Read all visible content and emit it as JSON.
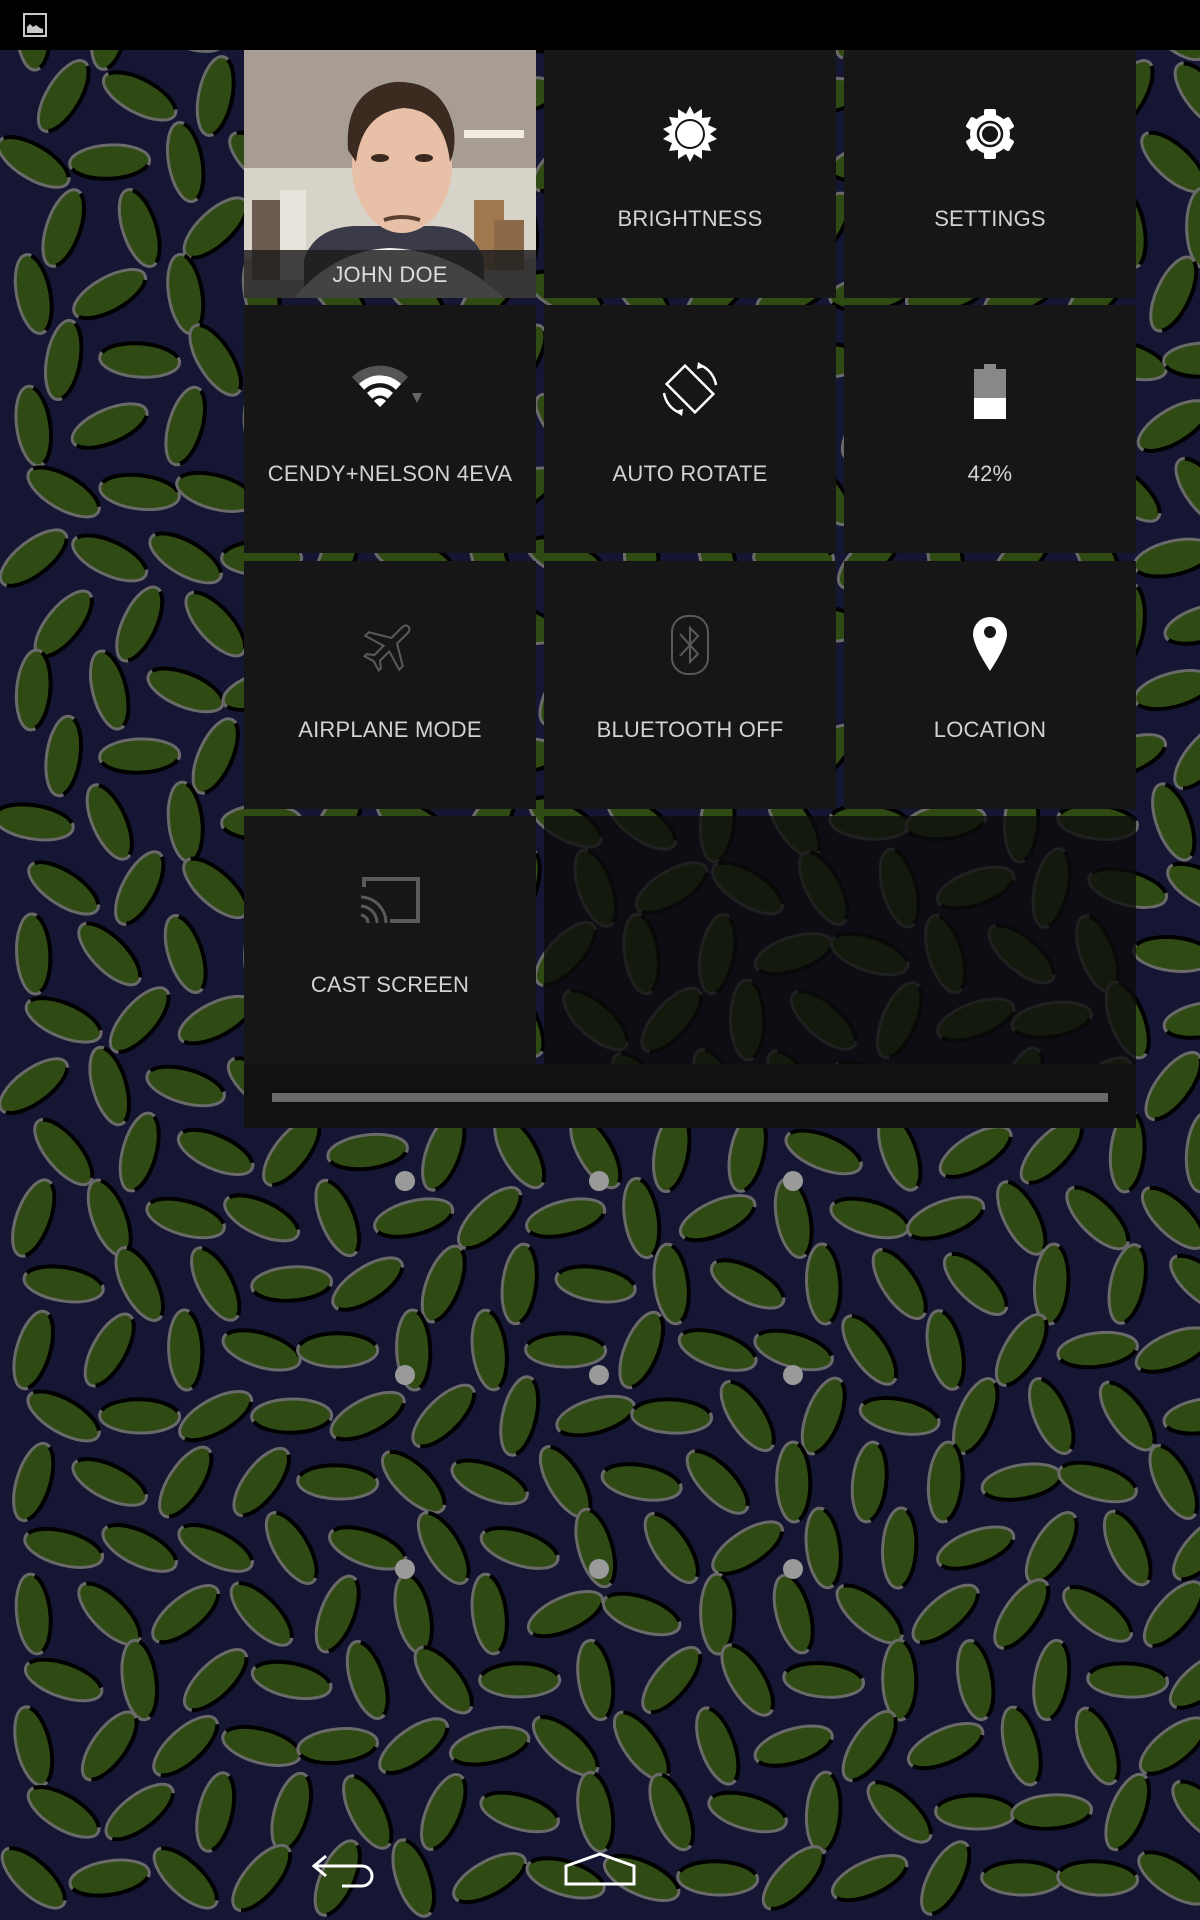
{
  "status_bar": {
    "notification_icon": "image-icon"
  },
  "quick_settings": {
    "user": {
      "name": "JOHN DOE",
      "icon": "user-photo"
    },
    "tiles": [
      {
        "id": "brightness",
        "label": "BRIGHTNESS",
        "icon": "brightness-icon",
        "state": "on"
      },
      {
        "id": "settings",
        "label": "SETTINGS",
        "icon": "gear-icon",
        "state": "on"
      },
      {
        "id": "wifi",
        "label": "CENDY+NELSON 4EVA",
        "icon": "wifi-icon",
        "state": "on",
        "signal_bars": 3,
        "signal_bars_max": 4
      },
      {
        "id": "auto-rotate",
        "label": "AUTO ROTATE",
        "icon": "rotate-icon",
        "state": "on"
      },
      {
        "id": "battery",
        "label": "42%",
        "icon": "battery-icon",
        "level_percent": 42
      },
      {
        "id": "airplane",
        "label": "AIRPLANE MODE",
        "icon": "airplane-icon",
        "state": "off"
      },
      {
        "id": "bluetooth",
        "label": "BLUETOOTH OFF",
        "icon": "bluetooth-icon",
        "state": "off"
      },
      {
        "id": "location",
        "label": "LOCATION",
        "icon": "location-pin-icon",
        "state": "on"
      },
      {
        "id": "cast",
        "label": "CAST SCREEN",
        "icon": "cast-icon",
        "state": "off"
      }
    ]
  },
  "lock_pattern": {
    "rows": 3,
    "cols": 3
  },
  "nav_bar": {
    "back_icon": "back-icon",
    "home_icon": "home-icon"
  },
  "colors": {
    "tile_bg": "#161616",
    "label": "#d2d2d2",
    "icon_active": "#ffffff",
    "icon_inactive": "#5a5a5a",
    "wallpaper_bg": "#141634",
    "leaf": "#2f4a12"
  }
}
